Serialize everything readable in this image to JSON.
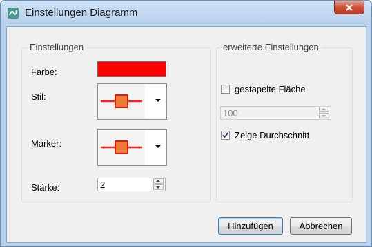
{
  "window": {
    "title": "Einstellungen Diagramm",
    "close_symbol": "x"
  },
  "settings": {
    "group_title": "Einstellungen",
    "color_label": "Farbe:",
    "color_value": "#ff0000",
    "style_label": "Stil:",
    "marker_label": "Marker:",
    "strength_label": "Stärke:",
    "strength_value": "2"
  },
  "advanced": {
    "group_title": "erweiterte Einstellungen",
    "stacked_area_label": "gestapelte Fläche",
    "stacked_area_checked": false,
    "stacked_value": "100",
    "show_average_label": "Zeige Durchschnitt",
    "show_average_checked": true
  },
  "buttons": {
    "add": "Hinzufügen",
    "cancel": "Abbrechen"
  },
  "icons": {
    "app": "chart-app-icon",
    "dropdown": "chevron-down-icon",
    "close": "close-icon"
  }
}
